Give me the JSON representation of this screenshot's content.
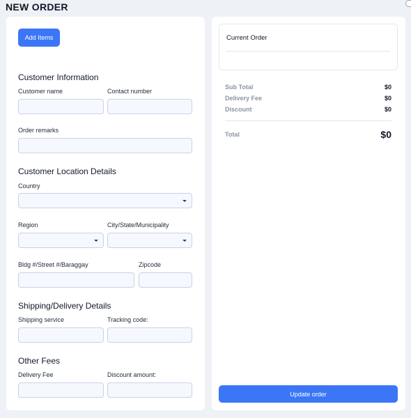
{
  "page": {
    "title": "NEW ORDER"
  },
  "left": {
    "add_items_label": "Add Items",
    "customer_info": {
      "title": "Customer Information",
      "customer_name_label": "Customer name",
      "contact_number_label": "Contact number",
      "order_remarks_label": "Order remarks"
    },
    "location": {
      "title": "Customer Location Details",
      "country_label": "Country",
      "region_label": "Region",
      "city_label": "City/State/Municipality",
      "street_label": "Bldg #/Street #/Baraggay",
      "zipcode_label": "Zipcode"
    },
    "shipping": {
      "title": "Shipping/Delivery Details",
      "service_label": "Shipping service",
      "tracking_label": "Tracking code:"
    },
    "fees": {
      "title": "Other Fees",
      "delivery_fee_label": "Delivery Fee",
      "discount_label": "Discount amount:"
    }
  },
  "right": {
    "current_order_title": "Current Order",
    "summary": {
      "subtotal_label": "Sub Total",
      "subtotal_value": "$0",
      "delivery_label": "Delivery Fee",
      "delivery_value": "$0",
      "discount_label": "Discount",
      "discount_value": "$0",
      "total_label": "Total",
      "total_value": "$0"
    },
    "update_label": "Update order"
  },
  "colors": {
    "accent": "#3b76f6",
    "input_bg": "#f5f8ff",
    "page_bg": "#eef1f6"
  }
}
